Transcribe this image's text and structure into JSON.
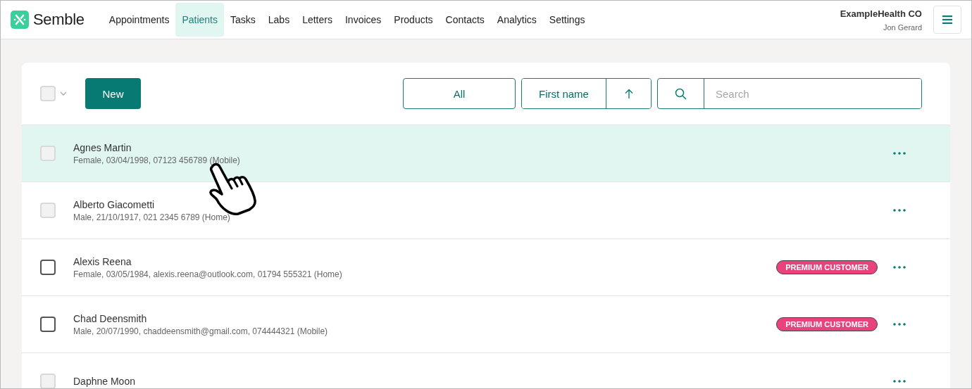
{
  "brand": {
    "name": "Semble"
  },
  "nav": [
    {
      "label": "Appointments",
      "selected": false
    },
    {
      "label": "Patients",
      "selected": true
    },
    {
      "label": "Tasks",
      "selected": false
    },
    {
      "label": "Labs",
      "selected": false
    },
    {
      "label": "Letters",
      "selected": false
    },
    {
      "label": "Invoices",
      "selected": false
    },
    {
      "label": "Products",
      "selected": false
    },
    {
      "label": "Contacts",
      "selected": false
    },
    {
      "label": "Analytics",
      "selected": false
    },
    {
      "label": "Settings",
      "selected": false
    }
  ],
  "account": {
    "organisation": "ExampleHealth CO",
    "user": "Jon Gerard"
  },
  "toolbar": {
    "select_all": {
      "checked": false
    },
    "new_button": "New",
    "filter": "All",
    "sort_field": "First name",
    "search": {
      "placeholder": "Search"
    }
  },
  "patients": [
    {
      "name": "Agnes Martin",
      "details": "Female, 03/04/1998, 07123 456789 (Mobile)",
      "selected": true,
      "dimmed": true
    },
    {
      "name": "Alberto Giacometti",
      "details": "Male, 21/10/1917, 021 2345 6789 (Home)",
      "selected": false,
      "dimmed": true
    },
    {
      "name": "Alexis Reena",
      "details": "Female, 03/05/1984, alexis.reena@outlook.com, 01794 555321 (Home)",
      "selected": false,
      "dimmed": false,
      "tag": "PREMIUM CUSTOMER"
    },
    {
      "name": "Chad Deensmith",
      "details": "Male, 20/07/1990, chaddeensmith@gmail.com, 074444321 (Mobile)",
      "selected": false,
      "dimmed": false,
      "tag": "PREMIUM CUSTOMER"
    },
    {
      "name": "Daphne Moon",
      "selected": false,
      "dimmed": true
    }
  ]
}
